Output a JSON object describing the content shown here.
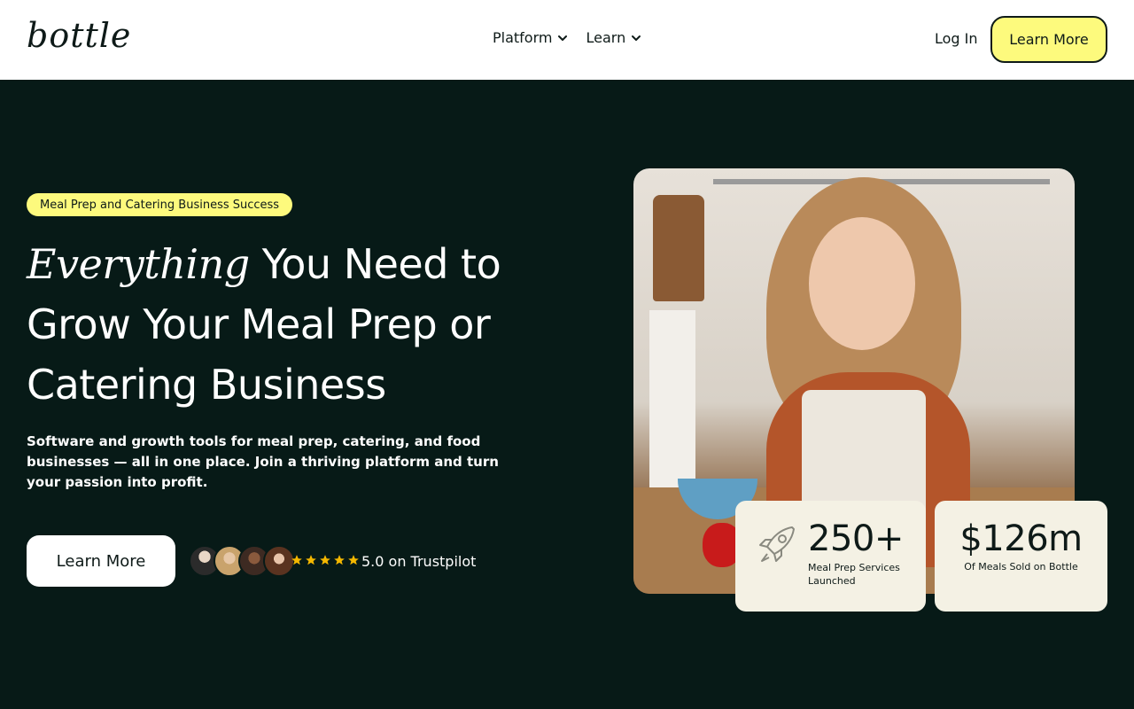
{
  "header": {
    "logo": "bottle",
    "nav": [
      {
        "label": "Platform"
      },
      {
        "label": "Learn"
      }
    ],
    "login_label": "Log In",
    "cta_label": "Learn More"
  },
  "hero": {
    "badge": "Meal Prep and Catering Business Success",
    "headline_em": "Everything",
    "headline_rest": "You Need to Grow Your Meal Prep or Catering Business",
    "subtitle": "Software and growth tools for meal prep, catering, and food businesses — all in one place. Join a thriving platform and turn your passion into profit.",
    "cta_label": "Learn More",
    "rating": {
      "stars": 5,
      "text": "5.0 on Trustpilot"
    }
  },
  "stats": [
    {
      "value": "250+",
      "label": "Meal Prep Services Launched",
      "icon": "rocket-icon"
    },
    {
      "value": "$126m",
      "label": "Of Meals Sold on Bottle"
    }
  ],
  "colors": {
    "background": "#071a17",
    "accent": "#fdfa7d",
    "card": "#f4f1e4",
    "star": "#f5b800"
  }
}
